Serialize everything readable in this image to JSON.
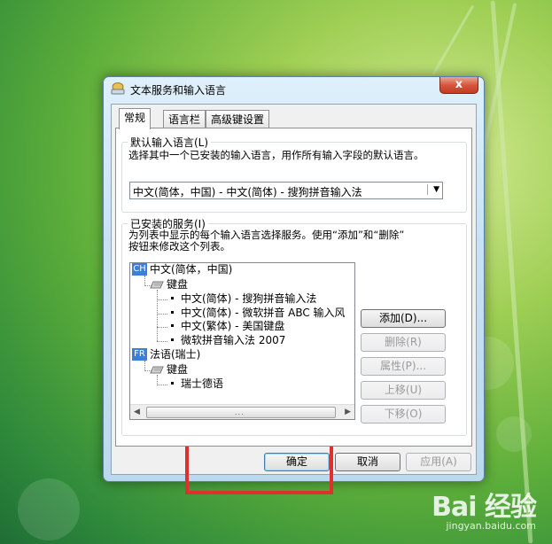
{
  "window": {
    "title": "文本服务和输入语言",
    "close_glyph": "x"
  },
  "tabs": [
    {
      "label": "常规"
    },
    {
      "label": "语言栏"
    },
    {
      "label": "高级键设置"
    }
  ],
  "default_language": {
    "legend": "默认输入语言(L)",
    "description": "选择其中一个已安装的输入语言，用作所有输入字段的默认语言。",
    "selected": "中文(简体，中国) - 中文(简体) - 搜狗拼音输入法"
  },
  "installed_services": {
    "legend": "已安装的服务(I)",
    "description_line1": "为列表中显示的每个输入语言选择服务。使用“添加”和“删除”",
    "description_line2": "按钮来修改这个列表。",
    "languages": [
      {
        "badge": "CH",
        "name": "中文(简体，中国)",
        "category": "键盘",
        "services": [
          "中文(简体) - 搜狗拼音输入法",
          "中文(简体) - 微软拼音 ABC 输入风",
          "中文(繁体) - 美国键盘",
          "微软拼音输入法 2007"
        ]
      },
      {
        "badge": "FR",
        "name": "法语(瑞士)",
        "category": "键盘",
        "services": [
          "瑞士德语"
        ]
      }
    ],
    "buttons": {
      "add": "添加(D)...",
      "remove": "删除(R)",
      "properties": "属性(P)...",
      "move_up": "上移(U)",
      "move_down": "下移(O)"
    }
  },
  "footer": {
    "ok": "确定",
    "cancel": "取消",
    "apply": "应用(A)"
  },
  "watermark": {
    "logo": "Bai 经验",
    "url": "jingyan.baidu.com"
  },
  "colors": {
    "annotation": "#e0302e",
    "lang_badge": "#3c7fd6"
  }
}
